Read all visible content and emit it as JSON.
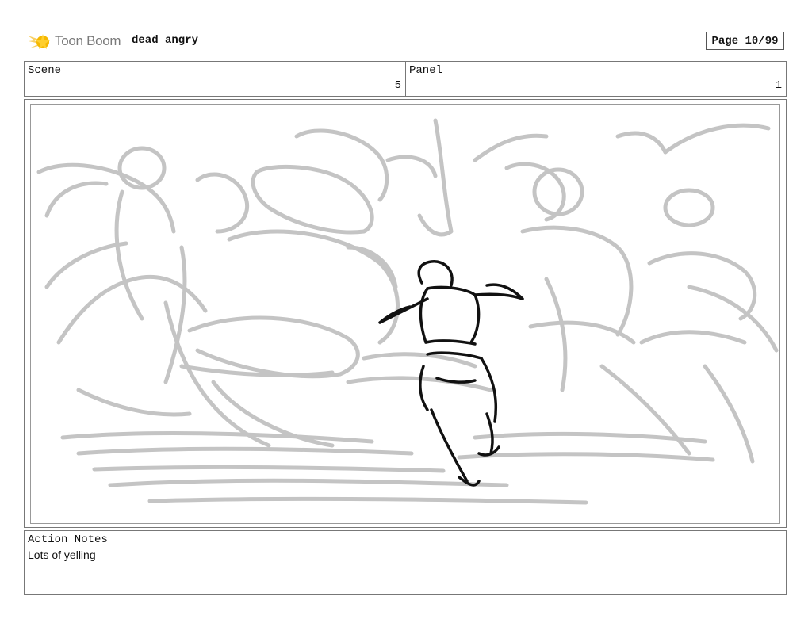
{
  "header": {
    "logo_text": "Toon Boom",
    "project_title": "dead angry",
    "page_label": "Page 10/99"
  },
  "scene": {
    "label": "Scene",
    "value": "5"
  },
  "panel": {
    "label": "Panel",
    "value": "1"
  },
  "notes": {
    "label": "Action Notes",
    "text": "Lots of yelling"
  },
  "colors": {
    "logo_star": "#f5b800",
    "sketch_light": "#c4c4c4",
    "sketch_dark": "#111111"
  }
}
